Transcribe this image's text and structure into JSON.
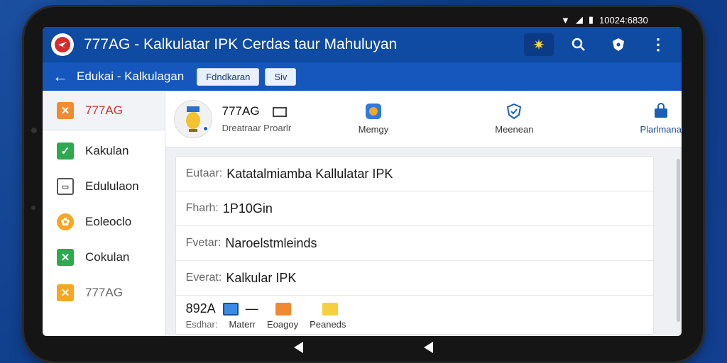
{
  "status": {
    "time": "10024:6830"
  },
  "app": {
    "title": "777AG - Kalkulatar IPK Cerdas taur Mahuluyan"
  },
  "subbar": {
    "title": "Edukai - Kalkulagan",
    "chip1": "Fdndkaran",
    "chip2": "Siv"
  },
  "sidebar": {
    "items": [
      {
        "label": "777AG",
        "color": "#f28a2e"
      },
      {
        "label": "Kakulan",
        "color": "#2fa84f"
      },
      {
        "label": "Edululaon",
        "color": "#555555"
      },
      {
        "label": "Eoleoclo",
        "color": "#f5a623"
      },
      {
        "label": "Cokulan",
        "color": "#2fa84f"
      },
      {
        "label": "777AG",
        "color": "#f5a623"
      }
    ]
  },
  "profile": {
    "name": "777AG",
    "sub": "Dreatraar Proarlr",
    "shortcuts": [
      "Memgy",
      "Meenean",
      "Plarlmana"
    ]
  },
  "rows": [
    {
      "k": "Eutaar:",
      "v": "Katatalmiamba Kallulatar IPK"
    },
    {
      "k": "Fharh:",
      "v": "1P10Gin"
    },
    {
      "k": "Fvetar:",
      "v": "Naroelstmleinds"
    },
    {
      "k": "Everat:",
      "v": "Kalkular IPK"
    }
  ],
  "last": {
    "code": "892A",
    "k": "Esdhar:",
    "labels": [
      "Materr",
      "Eoagoy",
      "Peaneds"
    ]
  }
}
